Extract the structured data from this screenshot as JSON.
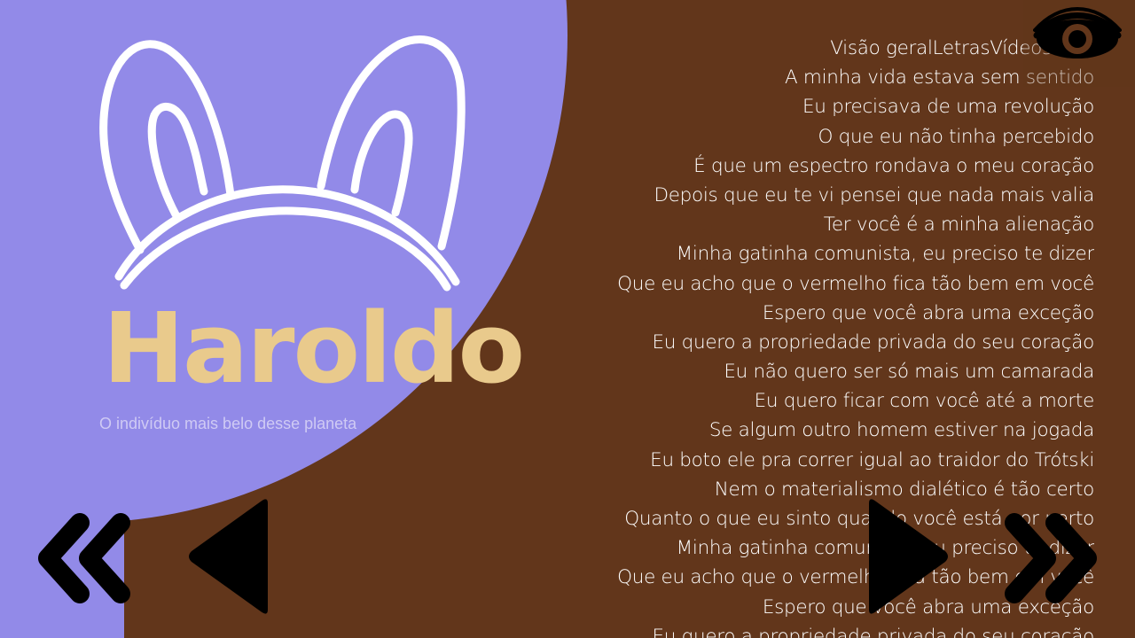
{
  "colors": {
    "background": "#62361b",
    "circle": "#928ae8",
    "title": "#e9ca8c",
    "subtitle": "#cfcaf4",
    "lyrics_text": "#ffffff",
    "controls": "#000000",
    "ears": "#ffffff"
  },
  "profile": {
    "title": "Haroldo",
    "subtitle": "O indivíduo mais belo desse planeta"
  },
  "lyrics": {
    "tabs_text": "Visão geralLetrasVídeosOuvi",
    "lines": [
      "A minha vida estava sem sentido",
      "Eu precisava de uma revolução",
      "O que eu não tinha percebido",
      "É que um espectro rondava o meu coração",
      "Depois que eu te vi pensei que nada mais valia",
      "Ter você é a minha alienação",
      "Minha gatinha comunista, eu preciso te dizer",
      "Que eu acho que o vermelho fica tão bem em você",
      "Espero que você abra uma exceção",
      "Eu quero a propriedade privada do seu coração",
      "Eu não quero ser só mais um camarada",
      "Eu quero ficar com você até a morte",
      "Se algum outro homem estiver na jogada",
      "Eu boto ele pra correr igual ao traidor do Trótski",
      "Nem o materialismo dialético é tão certo",
      "Quanto o que eu sinto quando você está por perto",
      "Minha gatinha comunista, eu preciso te dizer",
      "Que eu acho que o vermelho fica tão bem em você",
      "Espero que você abra uma exceção",
      "Eu quero a propriedade privada do seu coração"
    ]
  },
  "icons": {
    "ears": "bunny-ears-icon",
    "eye": "eye-icon",
    "rewind": "double-chevron-left-icon",
    "previous": "triangle-left-icon",
    "play": "triangle-right-icon",
    "forward": "double-chevron-right-icon"
  }
}
